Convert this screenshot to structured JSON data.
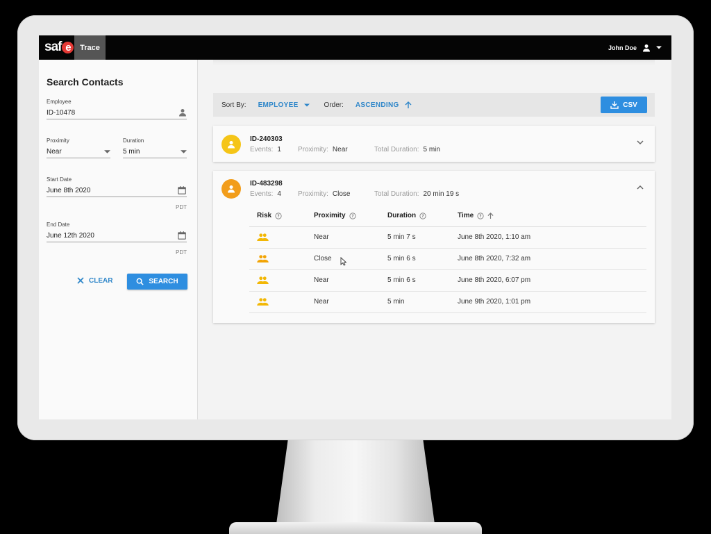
{
  "app": {
    "logo_text": "saf",
    "logo_e": "e",
    "active_tab": "Trace",
    "user_name": "John Doe"
  },
  "colors": {
    "accent": "#2e8ee0",
    "risk_icon": "#f2b705",
    "avatar_1": "#f5c518",
    "avatar_2": "#f29d1b",
    "logo_red": "#e53935"
  },
  "sidebar": {
    "title": "Search Contacts",
    "employee_label": "Employee",
    "employee_value": "ID-10478",
    "proximity_label": "Proximity",
    "proximity_value": "Near",
    "duration_label": "Duration",
    "duration_value": "5 min",
    "start_label": "Start Date",
    "start_value": "June 8th 2020",
    "start_tz": "PDT",
    "end_label": "End Date",
    "end_value": "June 12th 2020",
    "end_tz": "PDT",
    "clear_label": "CLEAR",
    "search_label": "SEARCH"
  },
  "sortbar": {
    "sort_label": "Sort By:",
    "sort_value": "EMPLOYEE",
    "order_label": "Order:",
    "order_value": "ASCENDING",
    "csv_label": "CSV"
  },
  "contacts": [
    {
      "id": "ID-240303",
      "events_label": "Events:",
      "events": "1",
      "proximity_label": "Proximity:",
      "proximity": "Near",
      "duration_label": "Total Duration:",
      "duration": "5 min",
      "expanded": false
    },
    {
      "id": "ID-483298",
      "events_label": "Events:",
      "events": "4",
      "proximity_label": "Proximity:",
      "proximity": "Close",
      "duration_label": "Total Duration:",
      "duration": "20 min 19 s",
      "expanded": true
    }
  ],
  "table": {
    "headers": {
      "risk": "Risk",
      "proximity": "Proximity",
      "duration": "Duration",
      "time": "Time"
    },
    "rows": [
      {
        "proximity": "Near",
        "duration": "5 min 7 s",
        "time": "June 8th 2020, 1:10 am"
      },
      {
        "proximity": "Close",
        "duration": "5 min 6 s",
        "time": "June 8th 2020, 7:32 am"
      },
      {
        "proximity": "Near",
        "duration": "5 min 6 s",
        "time": "June 8th 2020, 6:07 pm"
      },
      {
        "proximity": "Near",
        "duration": "5 min",
        "time": "June 9th 2020, 1:01 pm"
      }
    ]
  }
}
